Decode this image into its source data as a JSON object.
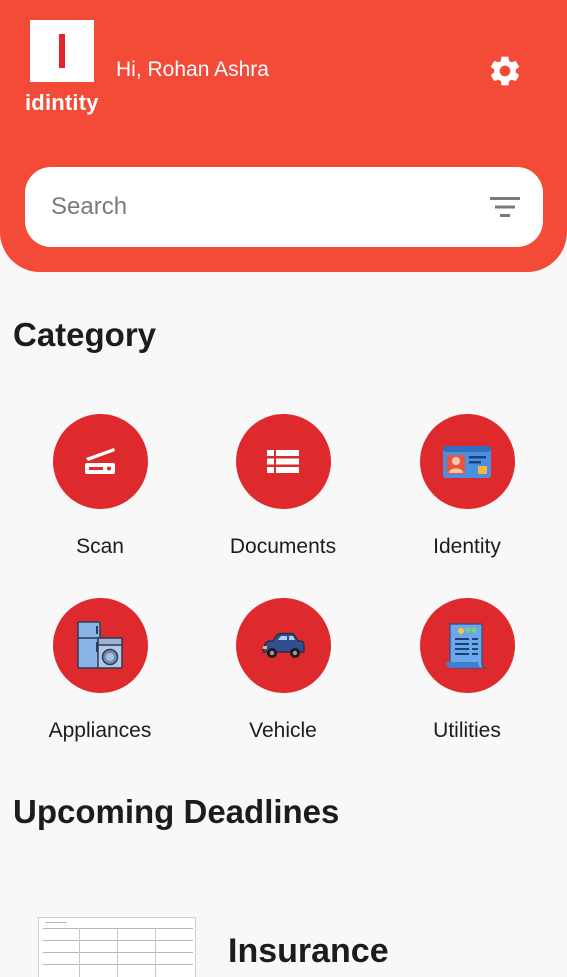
{
  "header": {
    "brand": "idintity",
    "logo_letter": "I",
    "greeting": "Hi, Rohan Ashra",
    "settings_icon": "gear-icon"
  },
  "search": {
    "placeholder": "Search",
    "filter_icon": "filter-icon"
  },
  "category": {
    "title": "Category",
    "items": [
      {
        "label": "Scan",
        "icon": "scanner-icon"
      },
      {
        "label": "Documents",
        "icon": "list-icon"
      },
      {
        "label": "Identity",
        "icon": "id-card-icon"
      },
      {
        "label": "Appliances",
        "icon": "appliances-icon"
      },
      {
        "label": "Vehicle",
        "icon": "car-icon"
      },
      {
        "label": "Utilities",
        "icon": "bill-icon"
      }
    ]
  },
  "deadlines": {
    "title": "Upcoming Deadlines",
    "items": [
      {
        "name": "Insurance"
      }
    ]
  },
  "colors": {
    "header_red": "#f44a38",
    "circle_red": "#de2a2d",
    "background": "#f8f8f8"
  }
}
